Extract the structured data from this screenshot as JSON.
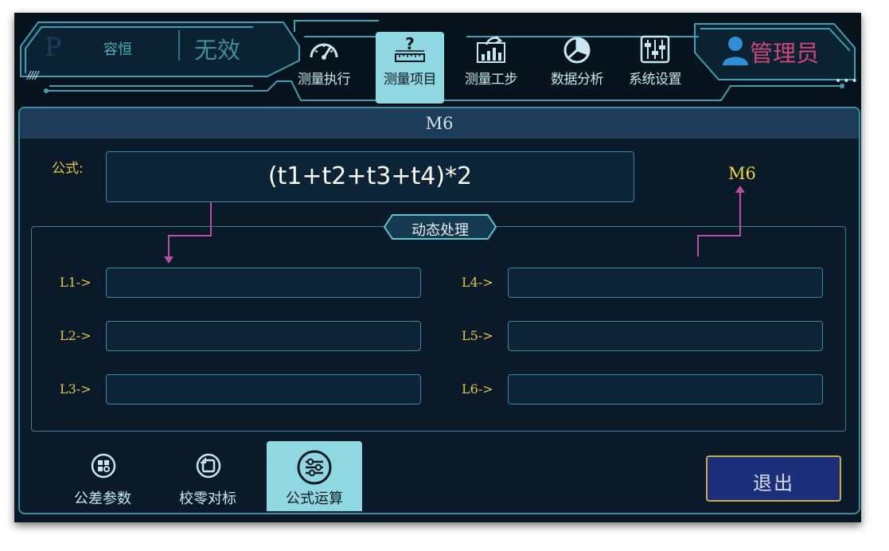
{
  "colors": {
    "background": "#081826",
    "accent": "#8fd8e2",
    "border": "#3b87a6",
    "label_gold": "#e6c34a",
    "result_gold": "#f2d43c",
    "user_pink": "#d0467c",
    "arrow_magenta": "#b84fa6",
    "exit_bg": "#1c2f7a"
  },
  "header": {
    "mode_letter": "P",
    "mode_label": "容恒",
    "mode_status": "无效",
    "user_icon": "user-icon",
    "user_name": "管理员"
  },
  "nav": {
    "items": [
      {
        "label": "测量执行",
        "icon": "gauge-icon",
        "active": false
      },
      {
        "label": "测量项目",
        "icon": "question-ruler-icon",
        "active": true
      },
      {
        "label": "测量工步",
        "icon": "step-chart-icon",
        "active": false
      },
      {
        "label": "数据分析",
        "icon": "pie-chart-icon",
        "active": false
      },
      {
        "label": "系统设置",
        "icon": "sliders-icon",
        "active": false
      }
    ]
  },
  "main": {
    "title": "M6",
    "formula_label": "公式:",
    "formula": "(t1+t2+t3+t4)*2",
    "result_label": "M6",
    "dynamic_label": "动态处理",
    "rows": [
      {
        "label": "L1->",
        "value": ""
      },
      {
        "label": "L2->",
        "value": ""
      },
      {
        "label": "L3->",
        "value": ""
      },
      {
        "label": "L4->",
        "value": ""
      },
      {
        "label": "L5->",
        "value": ""
      },
      {
        "label": "L6->",
        "value": ""
      }
    ]
  },
  "bottom_tabs": [
    {
      "label": "公差参数",
      "icon": "tolerance-icon",
      "active": false
    },
    {
      "label": "校零对标",
      "icon": "calibrate-icon",
      "active": false
    },
    {
      "label": "公式运算",
      "icon": "formula-sliders-icon",
      "active": true
    }
  ],
  "exit_label": "退出"
}
